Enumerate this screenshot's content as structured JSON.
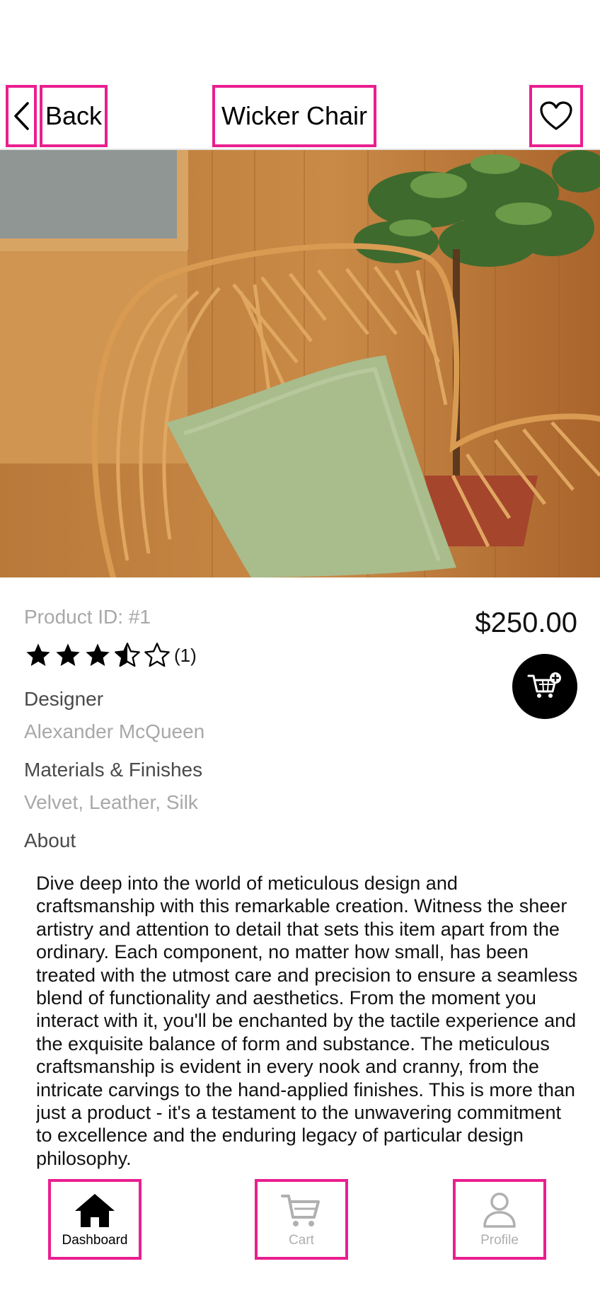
{
  "header": {
    "back_label": "Back",
    "title": "Wicker Chair",
    "icons": {
      "back": "chevron-left-icon",
      "favorite": "heart-icon"
    }
  },
  "product": {
    "id_text": "Product ID: #1",
    "price": "$250.00",
    "rating": {
      "value": 3.5,
      "max": 5,
      "count_text": "(1)"
    },
    "designer_label": "Designer",
    "designer": "Alexander McQueen",
    "materials_label": "Materials & Finishes",
    "materials": "Velvet, Leather, Silk",
    "about_label": "About",
    "about_text": "Dive deep into the world of meticulous design and craftsmanship with this remarkable creation. Witness the sheer artistry and attention to detail that sets this item apart from the ordinary. Each component, no matter how small, has been treated with the utmost care and precision to ensure a seamless blend of functionality and aesthetics. From the moment you interact with it, you'll be enchanted by the tactile experience and the exquisite balance of form and substance. The meticulous craftsmanship is evident in every nook and cranny, from the intricate carvings to the hand-applied finishes. This is more than just a product - it's a testament to the unwavering commitment to excellence and the enduring legacy of particular design philosophy."
  },
  "tabs": [
    {
      "label": "Dashboard",
      "icon": "home-icon",
      "active": true
    },
    {
      "label": "Cart",
      "icon": "cart-icon",
      "active": false
    },
    {
      "label": "Profile",
      "icon": "person-icon",
      "active": false
    }
  ],
  "colors": {
    "highlight": "#ea1f8f",
    "muted_text": "#a8a8a8",
    "label_text": "#4a4a4a",
    "tab_inactive": "#b0b0b0"
  }
}
